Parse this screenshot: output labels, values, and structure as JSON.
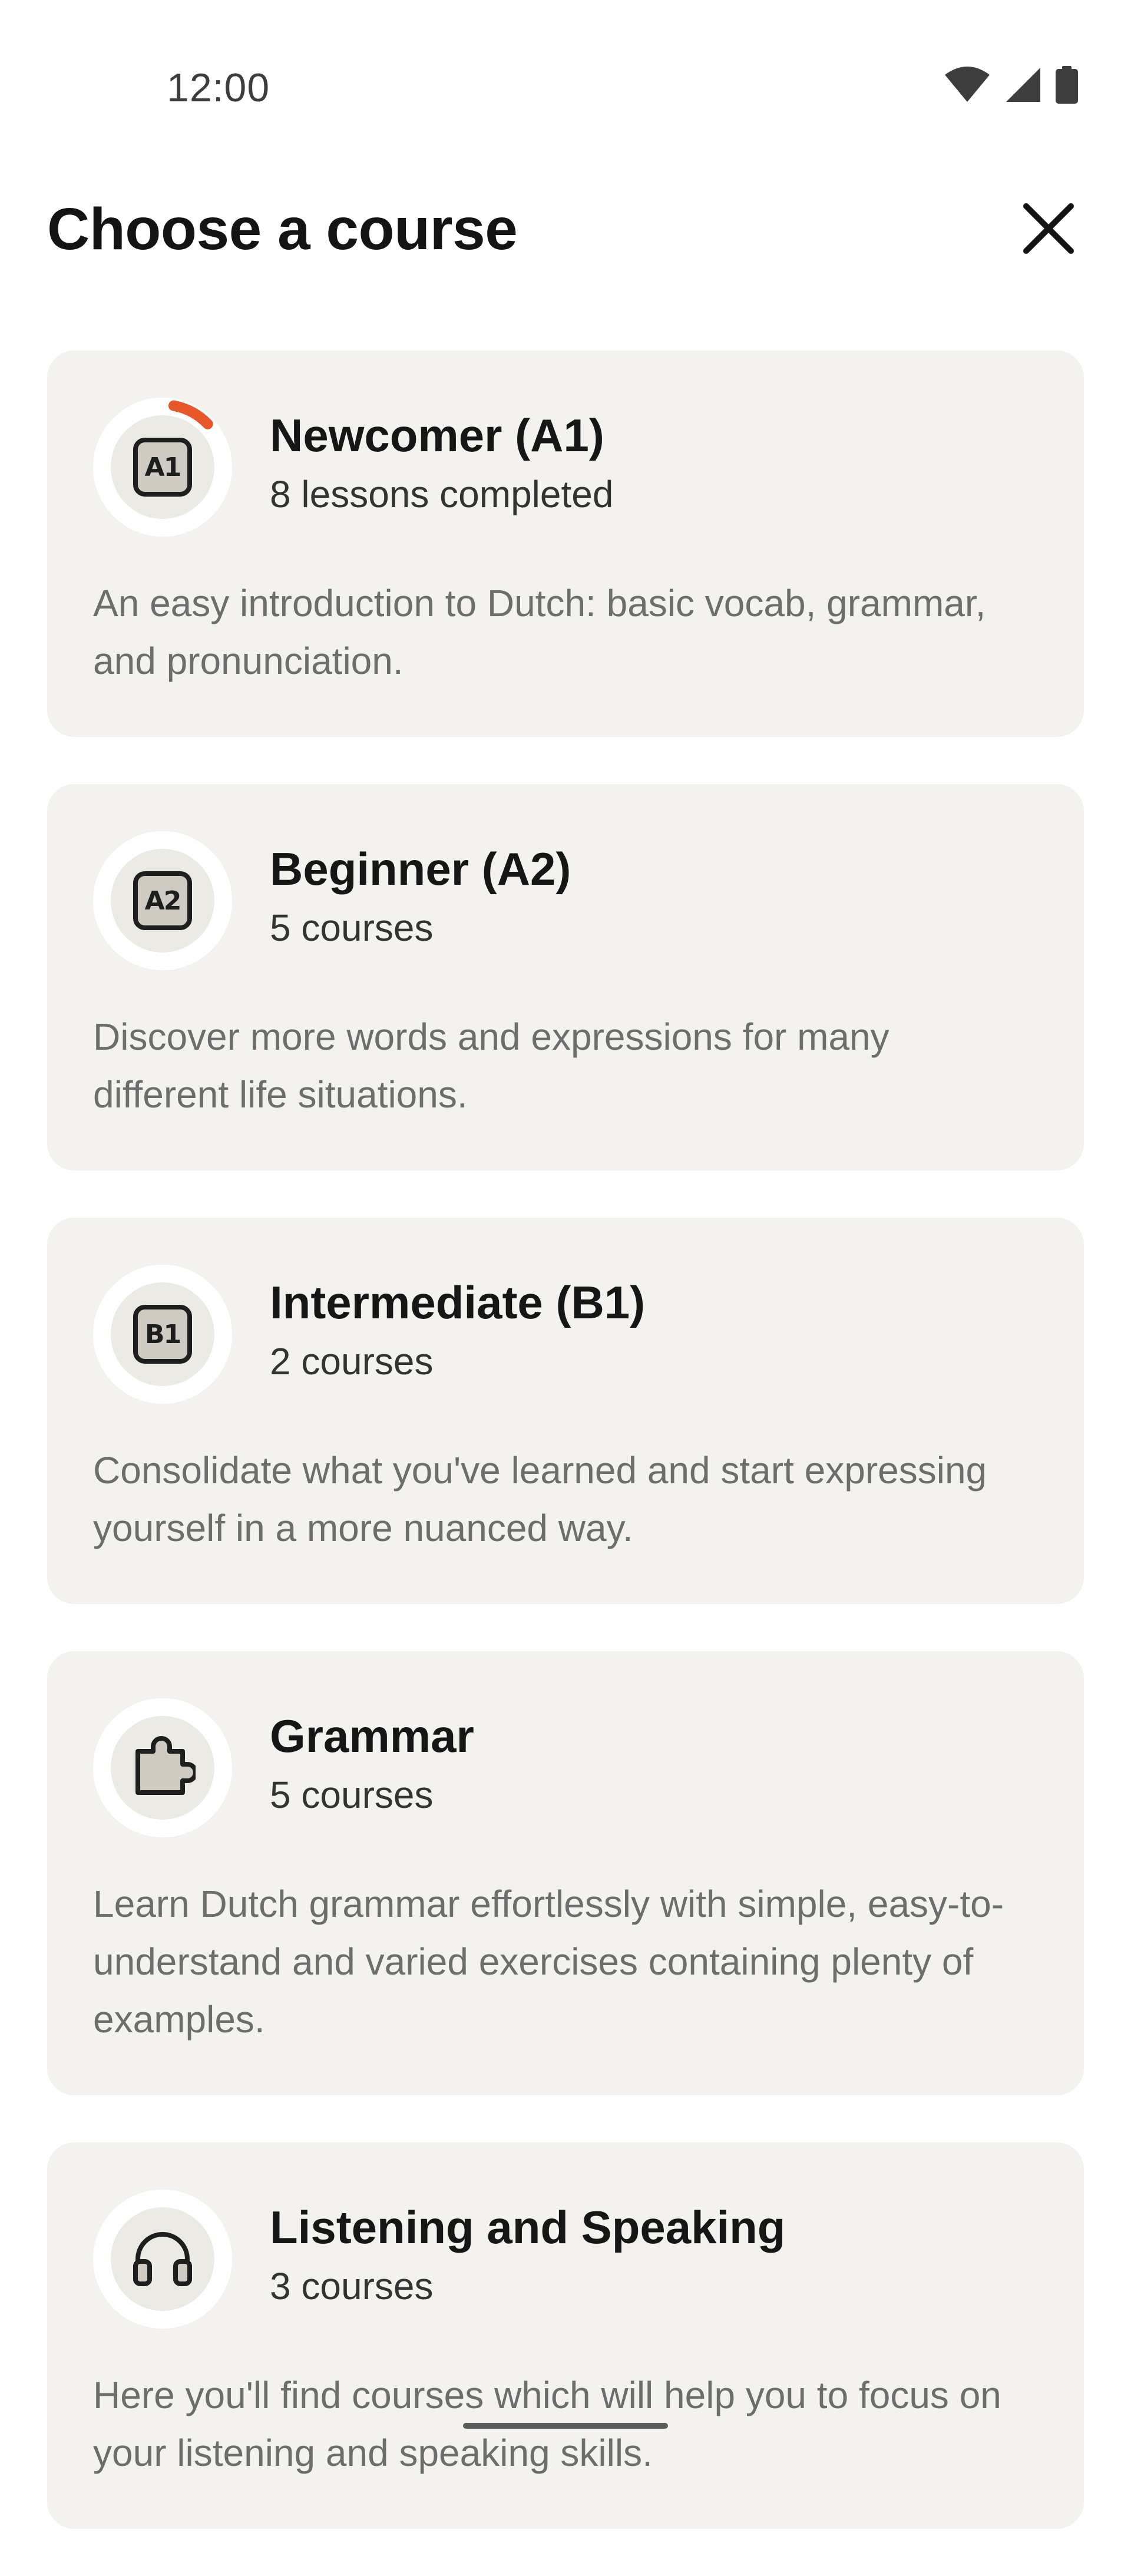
{
  "status_bar": {
    "time": "12:00",
    "icons": [
      "wifi-icon",
      "cellular-signal-icon",
      "battery-icon"
    ]
  },
  "header": {
    "title": "Choose a course",
    "close_icon": "close-icon"
  },
  "colors": {
    "card_background": "#f3f2ef",
    "progress_accent": "#e8572a",
    "badge_fill": "#cfcbc3"
  },
  "courses": [
    {
      "badge": "A1",
      "title": "Newcomer (A1)",
      "subtitle": "8 lessons completed",
      "description": "An easy introduction to Dutch: basic vocab, grammar, and pronunciation.",
      "progress": 0.1
    },
    {
      "badge": "A2",
      "title": "Beginner (A2)",
      "subtitle": "5 courses",
      "description": "Discover more words and expressions for many different life situations."
    },
    {
      "badge": "B1",
      "title": "Intermediate (B1)",
      "subtitle": "2 courses",
      "description": "Consolidate what you've learned and start expressing yourself in a more nuanced way."
    },
    {
      "icon": "puzzle-piece-icon",
      "title": "Grammar",
      "subtitle": "5 courses",
      "description": "Learn Dutch grammar effortlessly with simple, easy-to-understand and varied exercises containing plenty of examples."
    },
    {
      "icon": "headphones-icon",
      "title": "Listening and Speaking",
      "subtitle": "3 courses",
      "description": "Here you'll find courses which will help you to focus on your listening and speaking skills."
    }
  ]
}
